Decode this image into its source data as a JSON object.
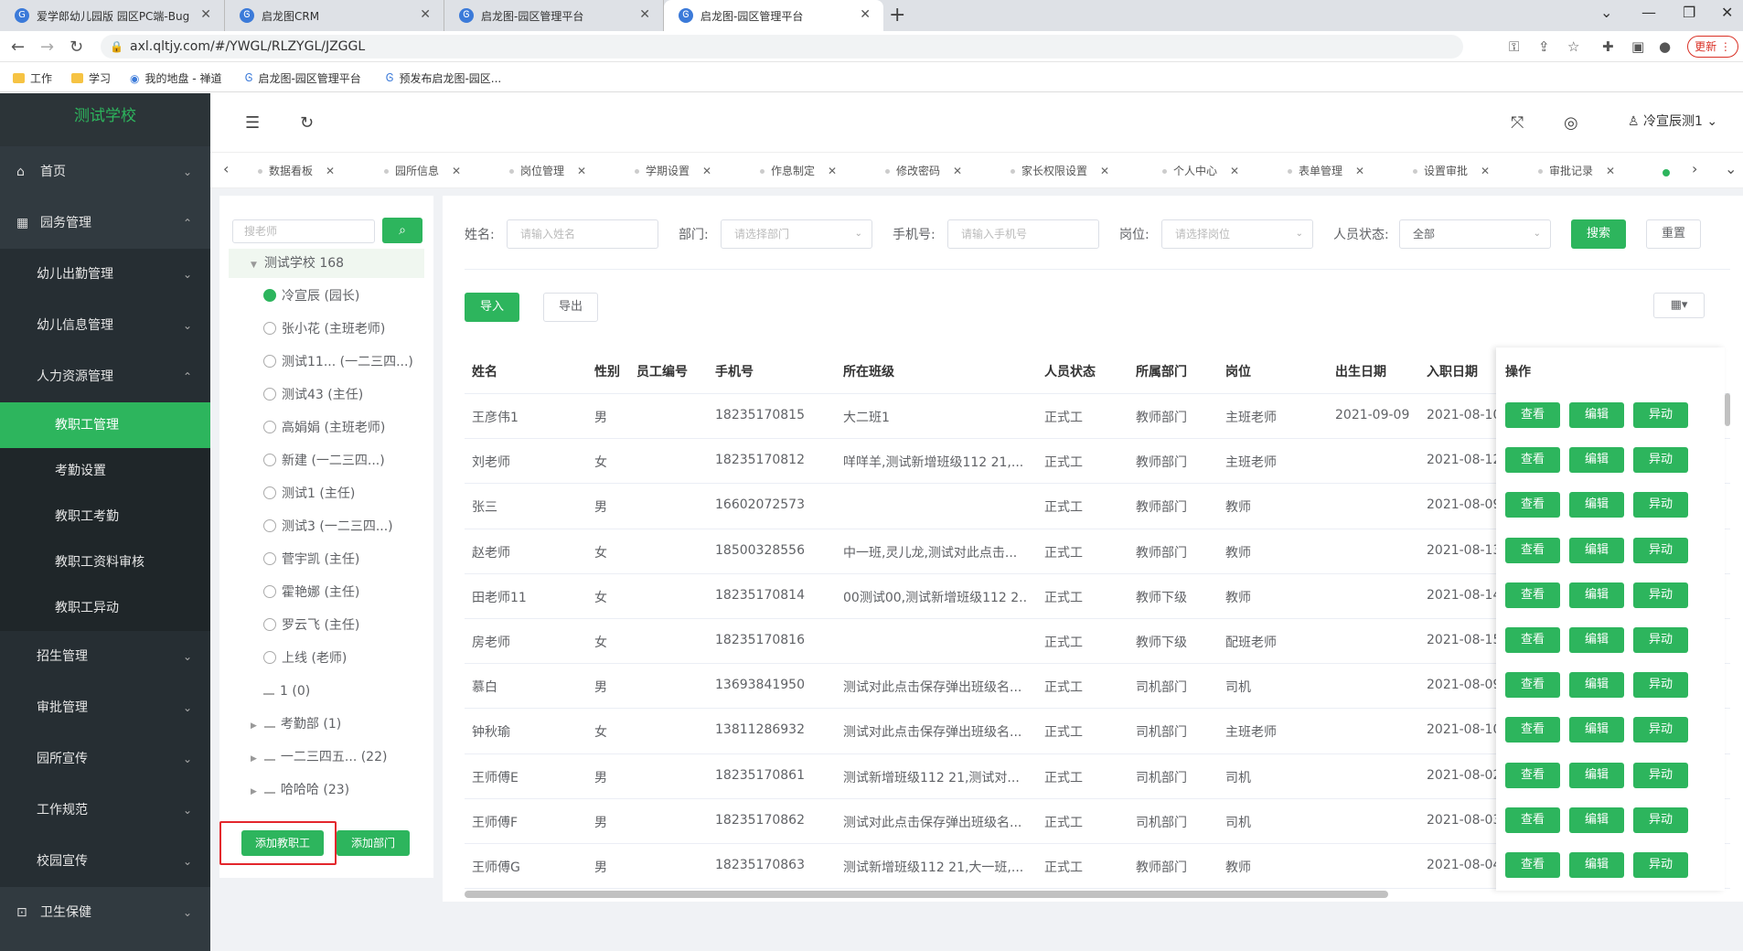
{
  "browser": {
    "tabs": [
      "爱学郎幼儿园版 园区PC端-Bug",
      "启龙图CRM",
      "启龙图-园区管理平台",
      "启龙图-园区管理平台"
    ],
    "url": "axl.qltjy.com/#/YWGL/RLZYGL/JZGGL",
    "update_label": "更新",
    "bookmarks": [
      "工作",
      "学习",
      "我的地盘 - 禅道",
      "启龙图-园区管理平台",
      "预发布启龙图-园区..."
    ]
  },
  "sidebar": {
    "school": "测试学校",
    "items": [
      "首页",
      "园务管理",
      "幼儿出勤管理",
      "幼儿信息管理",
      "人力资源管理",
      "教职工管理",
      "考勤设置",
      "教职工考勤",
      "教职工资料审核",
      "教职工异动",
      "招生管理",
      "审批管理",
      "园所宣传",
      "工作规范",
      "校园宣传",
      "卫生保健"
    ]
  },
  "header": {
    "user": "冷宣辰测1"
  },
  "tags": [
    "数据看板",
    "园所信息",
    "岗位管理",
    "学期设置",
    "作息制定",
    "修改密码",
    "家长权限设置",
    "个人中心",
    "表单管理",
    "设置审批",
    "审批记录"
  ],
  "tree": {
    "search_placeholder": "搜老师",
    "root": "测试学校 168",
    "people": [
      "冷宣辰 (园长)",
      "张小花 (主班老师)",
      "测试11... (一二三四...)",
      "测试43 (主任)",
      "高娟娟 (主班老师)",
      "新建 (一二三四...)",
      "测试1 (主任)",
      "测试3 (一二三四...)",
      "菅宇凯 (主任)",
      "霍艳娜 (主任)",
      "罗云飞 (主任)",
      "上线 (老师)"
    ],
    "groups": [
      "1 (0)",
      "考勤部 (1)",
      "一二三四五... (22)",
      "哈哈哈 (23)"
    ],
    "add_staff": "添加教职工",
    "add_dept": "添加部门"
  },
  "filters": {
    "name_label": "姓名:",
    "name_ph": "请输入姓名",
    "dept_label": "部门:",
    "dept_ph": "请选择部门",
    "phone_label": "手机号:",
    "phone_ph": "请输入手机号",
    "post_label": "岗位:",
    "post_ph": "请选择岗位",
    "status_label": "人员状态:",
    "status_value": "全部",
    "search": "搜索",
    "reset": "重置",
    "import": "导入",
    "export": "导出"
  },
  "table": {
    "columns": [
      "姓名",
      "性别",
      "员工编号",
      "手机号",
      "所在班级",
      "人员状态",
      "所属部门",
      "岗位",
      "出生日期",
      "入职日期",
      "操作"
    ],
    "rows": [
      [
        "王彦伟1",
        "男",
        "",
        "18235170815",
        "大二班1",
        "正式工",
        "教师部门",
        "主班老师",
        "2021-09-09",
        "2021-08-10"
      ],
      [
        "刘老师",
        "女",
        "",
        "18235170812",
        "咩咩羊,测试新增班级112 21,...",
        "正式工",
        "教师部门",
        "主班老师",
        "",
        "2021-08-12"
      ],
      [
        "张三",
        "男",
        "",
        "16602072573",
        "",
        "正式工",
        "教师部门",
        "教师",
        "",
        "2021-08-09"
      ],
      [
        "赵老师",
        "女",
        "",
        "18500328556",
        "中一班,灵儿龙,测试对此点击...",
        "正式工",
        "教师部门",
        "教师",
        "",
        "2021-08-13"
      ],
      [
        "田老师11",
        "女",
        "",
        "18235170814",
        "00测试00,测试新增班级112 2...",
        "正式工",
        "教师下级",
        "教师",
        "",
        "2021-08-14"
      ],
      [
        "房老师",
        "女",
        "",
        "18235170816",
        "",
        "正式工",
        "教师下级",
        "配班老师",
        "",
        "2021-08-15"
      ],
      [
        "慕白",
        "男",
        "",
        "13693841950",
        "测试对此点击保存弹出班级名...",
        "正式工",
        "司机部门",
        "司机",
        "",
        "2021-08-09"
      ],
      [
        "钟秋瑜",
        "女",
        "",
        "13811286932",
        "测试对此点击保存弹出班级名...",
        "正式工",
        "司机部门",
        "主班老师",
        "",
        "2021-08-10"
      ],
      [
        "王师傅E",
        "男",
        "",
        "18235170861",
        "测试新增班级112 21,测试对...",
        "正式工",
        "司机部门",
        "司机",
        "",
        "2021-08-02"
      ],
      [
        "王师傅F",
        "男",
        "",
        "18235170862",
        "测试对此点击保存弹出班级名...",
        "正式工",
        "司机部门",
        "司机",
        "",
        "2021-08-03"
      ],
      [
        "王师傅G",
        "男",
        "",
        "18235170863",
        "测试新增班级112 21,大一班,...",
        "正式工",
        "教师部门",
        "教师",
        "",
        "2021-08-04"
      ]
    ],
    "actions": [
      "查看",
      "编辑",
      "异动"
    ]
  }
}
